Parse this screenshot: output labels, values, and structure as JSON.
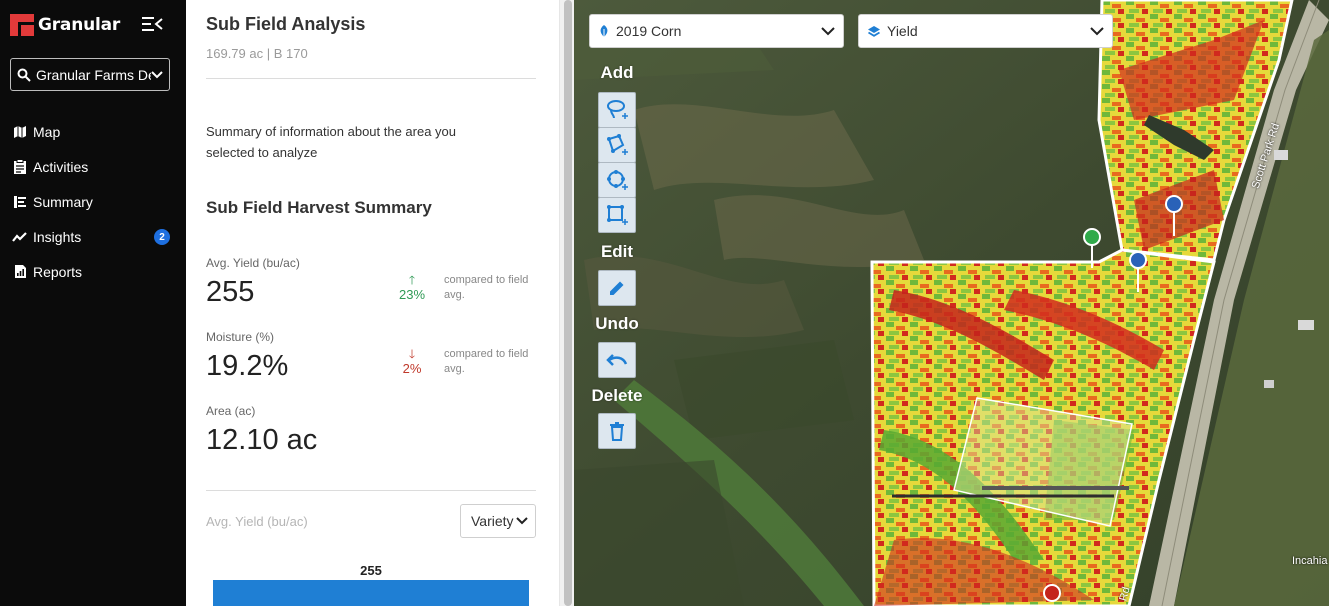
{
  "app": {
    "logo_text": "Granular"
  },
  "sidebar": {
    "farm_select": "Granular Farms De",
    "items": [
      {
        "label": "Map",
        "icon": "map-icon"
      },
      {
        "label": "Activities",
        "icon": "clipboard-icon"
      },
      {
        "label": "Summary",
        "icon": "summary-icon"
      },
      {
        "label": "Insights",
        "icon": "trend-icon",
        "badge": "2"
      },
      {
        "label": "Reports",
        "icon": "report-icon"
      }
    ]
  },
  "panel": {
    "title": "Sub Field Analysis",
    "subtitle": "169.79 ac | B 170",
    "description": "Summary of information about the area you selected to analyze",
    "section_title": "Sub Field Harvest Summary",
    "metrics": [
      {
        "label": "Avg. Yield (bu/ac)",
        "value": "255",
        "delta": "23%",
        "direction": "up",
        "compare": "compared to field avg."
      },
      {
        "label": "Moisture (%)",
        "value": "19.2%",
        "delta": "2%",
        "direction": "down",
        "compare": "compared to field avg."
      },
      {
        "label": "Area (ac)",
        "value": "12.10 ac"
      }
    ],
    "chart": {
      "label": "Avg. Yield (bu/ac)",
      "group_select": "Variety"
    }
  },
  "chart_data": {
    "type": "bar",
    "categories": [
      ""
    ],
    "values": [
      255
    ],
    "ylabel": "Avg. Yield (bu/ac)"
  },
  "map": {
    "crop_select": "2019 Corn",
    "layer_select": "Yield",
    "tools": {
      "add_label": "Add",
      "edit_label": "Edit",
      "undo_label": "Undo",
      "delete_label": "Delete"
    },
    "road_label": "Scott Park Rd",
    "road_label_bottom": "Rd",
    "place_label": "Incahia"
  },
  "colors": {
    "accent": "#1f7fd4",
    "brand": "#e23a3a",
    "up": "#2f9a55",
    "down": "#c0392b"
  }
}
